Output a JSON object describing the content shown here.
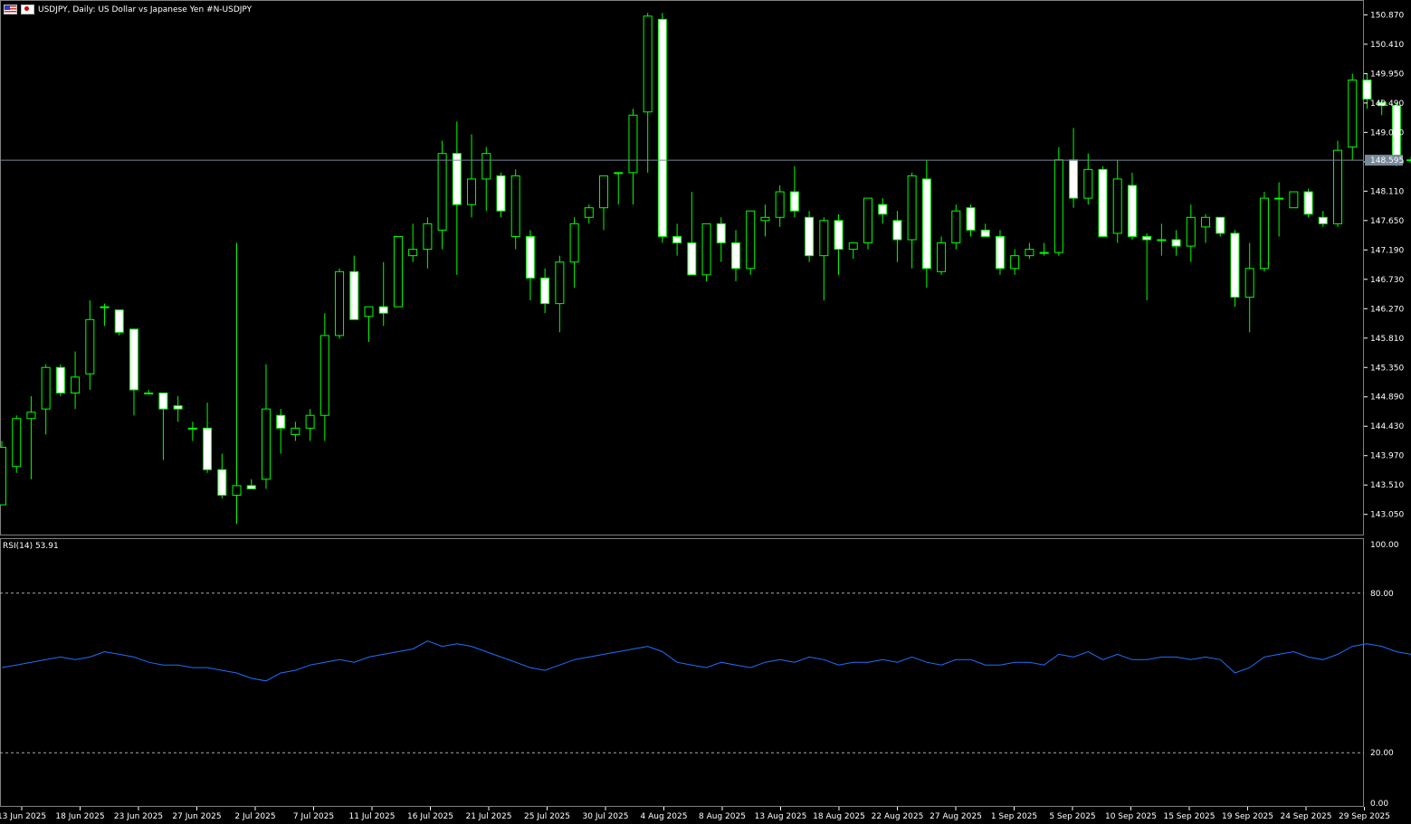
{
  "header": {
    "title": "USDJPY, Daily:  US Dollar vs  Japanese Yen #N-USDJPY",
    "icons": [
      "us-flag-icon",
      "jp-flag-icon"
    ]
  },
  "rsi": {
    "label": "RSI(14) 53.91"
  },
  "colors": {
    "background": "#000000",
    "up": "#00ff00",
    "body_up_fill": "#000000",
    "body_down_fill": "#ffffff",
    "rsi_line": "#1e6fff",
    "price_line": "#778899"
  },
  "chart_data": [
    {
      "type": "candlestick",
      "title": "USDJPY, Daily:  US Dollar vs  Japanese Yen #N-USDJPY",
      "ylim": [
        142.72,
        151.06
      ],
      "y_ticks": [
        "150.870",
        "150.410",
        "149.950",
        "149.490",
        "149.030",
        "148.570",
        "148.110",
        "147.650",
        "147.190",
        "146.730",
        "146.270",
        "145.810",
        "145.350",
        "144.890",
        "144.430",
        "143.970",
        "143.510",
        "143.050"
      ],
      "current_price": "148.595",
      "x_ticks": [
        "13 Jun 2025",
        "18 Jun 2025",
        "23 Jun 2025",
        "27 Jun 2025",
        "2 Jul 2025",
        "7 Jul 2025",
        "11 Jul 2025",
        "16 Jul 2025",
        "21 Jul 2025",
        "25 Jul 2025",
        "30 Jul 2025",
        "4 Aug 2025",
        "8 Aug 2025",
        "13 Aug 2025",
        "18 Aug 2025",
        "22 Aug 2025",
        "27 Aug 2025",
        "1 Sep 2025",
        "5 Sep 2025",
        "10 Sep 2025",
        "15 Sep 2025",
        "19 Sep 2025",
        "24 Sep 2025",
        "29 Sep 2025"
      ],
      "ohlc": [
        [
          143.2,
          144.2,
          143.2,
          144.1
        ],
        [
          143.8,
          144.6,
          143.7,
          144.55
        ],
        [
          144.55,
          144.9,
          143.6,
          144.65
        ],
        [
          144.7,
          145.4,
          144.3,
          145.35
        ],
        [
          145.35,
          145.4,
          144.9,
          144.95
        ],
        [
          144.95,
          145.6,
          144.7,
          145.2
        ],
        [
          145.25,
          146.4,
          145.0,
          146.1
        ],
        [
          146.3,
          146.35,
          146.0,
          146.3
        ],
        [
          146.25,
          146.2,
          145.85,
          145.9
        ],
        [
          145.95,
          145.95,
          144.6,
          145.0
        ],
        [
          144.95,
          145.0,
          144.95,
          144.95
        ],
        [
          144.95,
          144.7,
          143.9,
          144.7
        ],
        [
          144.75,
          144.9,
          144.5,
          144.7
        ],
        [
          144.4,
          144.5,
          144.2,
          144.4
        ],
        [
          144.4,
          144.8,
          143.7,
          143.75
        ],
        [
          143.75,
          144.0,
          143.3,
          143.35
        ],
        [
          143.35,
          147.3,
          142.9,
          143.5
        ],
        [
          143.5,
          143.6,
          143.45,
          143.45
        ],
        [
          143.6,
          145.4,
          143.45,
          144.7
        ],
        [
          144.6,
          144.7,
          144.0,
          144.4
        ],
        [
          144.3,
          144.5,
          144.2,
          144.4
        ],
        [
          144.4,
          144.7,
          144.2,
          144.6
        ],
        [
          144.6,
          146.2,
          144.2,
          145.85
        ],
        [
          145.85,
          146.9,
          145.8,
          146.85
        ],
        [
          146.85,
          147.1,
          146.1,
          146.1
        ],
        [
          146.15,
          146.3,
          145.75,
          146.3
        ],
        [
          146.3,
          147.0,
          146.0,
          146.2
        ],
        [
          146.3,
          147.35,
          146.3,
          147.4
        ],
        [
          147.1,
          147.6,
          147.0,
          147.2
        ],
        [
          147.2,
          147.7,
          146.9,
          147.6
        ],
        [
          147.5,
          148.9,
          147.2,
          148.7
        ],
        [
          148.7,
          149.2,
          146.8,
          147.9
        ],
        [
          147.9,
          149.0,
          147.7,
          148.3
        ],
        [
          148.3,
          148.8,
          147.8,
          148.7
        ],
        [
          148.35,
          148.4,
          147.7,
          147.8
        ],
        [
          147.4,
          148.45,
          147.2,
          148.35
        ],
        [
          147.4,
          147.5,
          146.4,
          146.75
        ],
        [
          146.75,
          146.9,
          146.2,
          146.35
        ],
        [
          146.35,
          147.1,
          145.9,
          147.0
        ],
        [
          147.0,
          147.7,
          146.6,
          147.6
        ],
        [
          147.7,
          147.9,
          147.6,
          147.85
        ],
        [
          147.85,
          148.3,
          147.5,
          148.35
        ],
        [
          148.4,
          148.4,
          147.9,
          148.4
        ],
        [
          148.4,
          149.4,
          147.9,
          149.3
        ],
        [
          149.35,
          150.9,
          148.4,
          150.85
        ],
        [
          150.8,
          150.9,
          147.3,
          147.4
        ],
        [
          147.4,
          147.6,
          147.1,
          147.3
        ],
        [
          147.3,
          148.1,
          146.8,
          146.8
        ],
        [
          146.8,
          147.6,
          146.7,
          147.6
        ],
        [
          147.6,
          147.7,
          147.0,
          147.3
        ],
        [
          147.3,
          147.5,
          146.7,
          146.9
        ],
        [
          146.9,
          147.8,
          146.8,
          147.8
        ],
        [
          147.65,
          147.9,
          147.4,
          147.7
        ],
        [
          147.7,
          148.2,
          147.55,
          148.1
        ],
        [
          148.1,
          148.5,
          147.7,
          147.8
        ],
        [
          147.7,
          147.8,
          147.0,
          147.1
        ],
        [
          147.1,
          147.7,
          146.4,
          147.65
        ],
        [
          147.65,
          147.75,
          146.8,
          147.2
        ],
        [
          147.2,
          147.3,
          147.05,
          147.3
        ],
        [
          147.3,
          148.0,
          147.2,
          148.0
        ],
        [
          147.9,
          148.0,
          147.6,
          147.75
        ],
        [
          147.65,
          147.8,
          147.0,
          147.35
        ],
        [
          147.35,
          148.4,
          146.9,
          148.35
        ],
        [
          148.3,
          148.6,
          146.6,
          146.9
        ],
        [
          146.85,
          147.4,
          146.8,
          147.3
        ],
        [
          147.3,
          147.9,
          147.2,
          147.8
        ],
        [
          147.85,
          147.9,
          147.4,
          147.5
        ],
        [
          147.5,
          147.6,
          147.4,
          147.4
        ],
        [
          147.4,
          147.5,
          146.8,
          146.9
        ],
        [
          146.9,
          147.2,
          146.8,
          147.1
        ],
        [
          147.1,
          147.3,
          147.05,
          147.2
        ],
        [
          147.15,
          147.3,
          147.1,
          147.15
        ],
        [
          147.15,
          148.8,
          147.1,
          148.6
        ],
        [
          148.6,
          149.1,
          147.85,
          148.0
        ],
        [
          148.0,
          148.7,
          147.9,
          148.45
        ],
        [
          148.45,
          148.5,
          147.4,
          147.4
        ],
        [
          147.45,
          148.6,
          147.3,
          148.3
        ],
        [
          148.2,
          148.4,
          147.35,
          147.4
        ],
        [
          147.4,
          147.45,
          146.4,
          147.35
        ],
        [
          147.35,
          147.6,
          147.1,
          147.35
        ],
        [
          147.35,
          147.5,
          147.1,
          147.25
        ],
        [
          147.25,
          147.9,
          147.0,
          147.7
        ],
        [
          147.55,
          147.75,
          147.3,
          147.7
        ],
        [
          147.7,
          147.7,
          147.4,
          147.45
        ],
        [
          147.45,
          147.5,
          146.3,
          146.45
        ],
        [
          146.45,
          147.3,
          145.9,
          146.9
        ],
        [
          146.9,
          148.1,
          146.85,
          148.0
        ],
        [
          148.0,
          148.25,
          147.4,
          148.0
        ],
        [
          147.85,
          148.1,
          148.0,
          148.1
        ],
        [
          148.1,
          148.15,
          147.7,
          147.75
        ],
        [
          147.7,
          147.8,
          147.55,
          147.6
        ],
        [
          147.6,
          148.9,
          147.55,
          148.75
        ],
        [
          148.8,
          149.95,
          148.6,
          149.85
        ],
        [
          149.85,
          149.95,
          149.4,
          149.55
        ],
        [
          149.5,
          149.55,
          149.3,
          149.45
        ],
        [
          149.45,
          149.5,
          148.5,
          148.6
        ],
        [
          148.59,
          148.65,
          148.55,
          148.6
        ]
      ]
    },
    {
      "type": "line",
      "title": "RSI(14) 53.91",
      "ylim": [
        0,
        100
      ],
      "y_ticks": [
        "100.00",
        "80.00",
        "20.00",
        "0.00"
      ],
      "levels": [
        80,
        20
      ],
      "series": [
        {
          "values": [
            52,
            53,
            54,
            55,
            56,
            55,
            56,
            58,
            57,
            56,
            54,
            53,
            53,
            52,
            52,
            51,
            50,
            48,
            47,
            50,
            51,
            53,
            54,
            55,
            54,
            56,
            57,
            58,
            59,
            62,
            60,
            61,
            60,
            58,
            56,
            54,
            52,
            51,
            53,
            55,
            56,
            57,
            58,
            59,
            60,
            58,
            54,
            53,
            52,
            54,
            53,
            52,
            54,
            55,
            54,
            56,
            55,
            53,
            54,
            54,
            55,
            54,
            56,
            54,
            53,
            55,
            55,
            53,
            53,
            54,
            54,
            53,
            57,
            56,
            58,
            55,
            57,
            55,
            55,
            56,
            56,
            55,
            56,
            55,
            50,
            52,
            56,
            57,
            58,
            56,
            55,
            57,
            60,
            61,
            60,
            58,
            57
          ]
        }
      ]
    }
  ]
}
